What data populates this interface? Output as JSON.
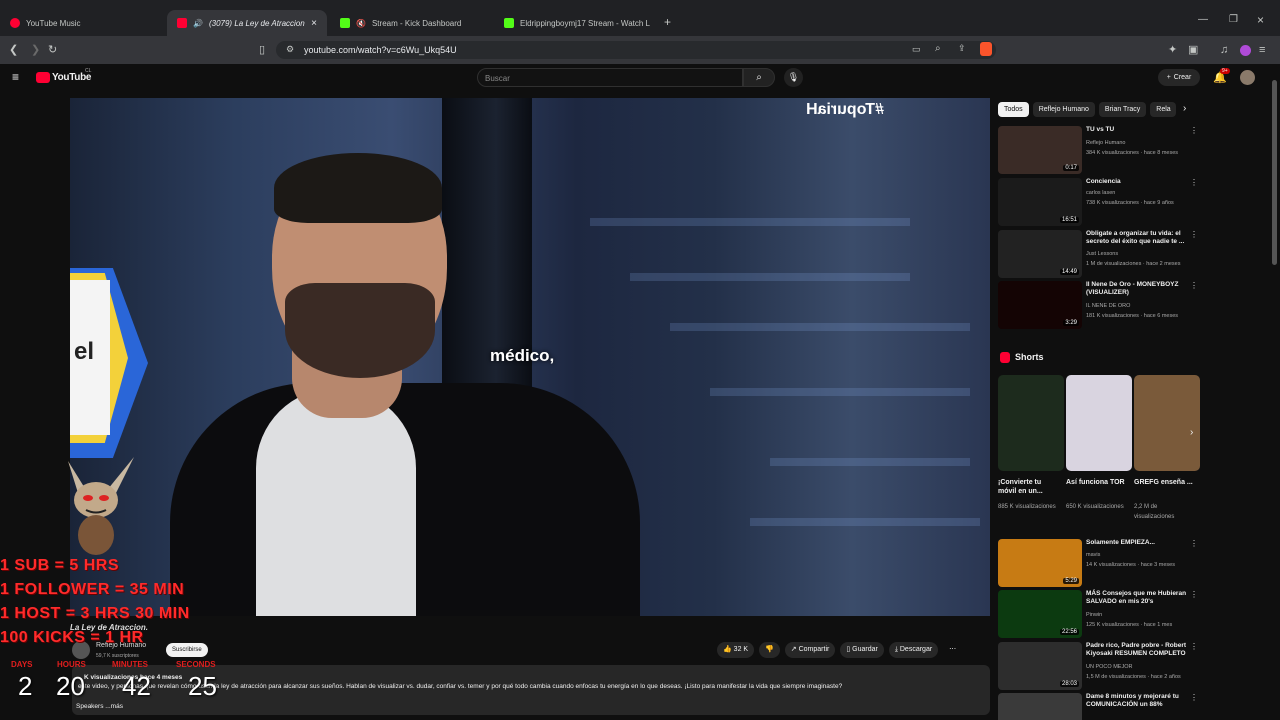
{
  "browser": {
    "tabs": [
      {
        "label": "YouTube Music",
        "color": "#ff0033"
      },
      {
        "label": "(3079) La Ley de Atraccion",
        "color": "#ff0033"
      },
      {
        "label": "Stream - Kick Dashboard",
        "color": "#53fc18"
      },
      {
        "label": "Eldrippingboymj17 Stream - Watch L",
        "color": "#53fc18"
      }
    ],
    "url": "youtube.com/watch?v=c6Wu_Ukq54U"
  },
  "youtube": {
    "logo": "YouTube",
    "region": "CL",
    "search_placeholder": "Buscar",
    "create_label": "Crear",
    "notif_count": "9+"
  },
  "video": {
    "caption": "médico,",
    "hashtag": "#TopuriaH",
    "watermark": "La Ley de Atraccion.",
    "channel": "Reflejo Humano",
    "subs": "59,7 K suscriptores",
    "subscribe_label": "Suscribirse",
    "likes": "32 K",
    "share_label": "Compartir",
    "save_label": "Guardar",
    "download_label": "Descargar",
    "desc_meta": "K visualizaciones hace 4 meses",
    "desc_text": "este video, y personas que revelan cómo usan la ley de atracción para alcanzar sus sueños. Hablan de visualizar vs. dudar, confiar vs. temer y por qué todo cambia cuando enfocas tu energía en lo que deseas. ¡Listo para manifestar la vida que siempre imaginaste?",
    "more_label": "Speakers ...más"
  },
  "chips": [
    "Todos",
    "Reflejo Humano",
    "Brian Tracy",
    "Rela"
  ],
  "related": [
    {
      "title": "TU vs TU",
      "channel": "Reflejo Humano",
      "meta": "384 K visualizaciones · hace 8 meses",
      "duration": "0:17",
      "thumb": "#3a2b26"
    },
    {
      "title": "Conciencia",
      "channel": "carlos lasen",
      "meta": "738 K visualizaciones · hace 9 años",
      "duration": "16:51",
      "thumb": "#1b1b1b"
    },
    {
      "title": "Obligate a organizar tu vida: el secreto del éxito que nadie te ...",
      "channel": "Just Lessons",
      "meta": "1 M de visualizaciones · hace 2 meses",
      "duration": "14:49",
      "thumb": "#222222"
    },
    {
      "title": "Il Nene De Oro - MONEYBOYZ (VISUALIZER)",
      "channel": "IL NENE DE ORO",
      "meta": "181 K visualizaciones · hace 6 meses",
      "duration": "3:29",
      "thumb": "#140404"
    }
  ],
  "shorts_title": "Shorts",
  "shorts": [
    {
      "title": "¡Convierte tu móvil en un...",
      "views": "885 K visualizaciones",
      "thumb": "#1d2b1d"
    },
    {
      "title": "Así funciona TOR",
      "views": "650 K visualizaciones",
      "thumb": "#d9d4e0"
    },
    {
      "title": "GREFG enseña ...",
      "views": "2,2 M de visualizaciones",
      "thumb": "#7a5a3a"
    }
  ],
  "related2": [
    {
      "title": "Solamente EMPIEZA...",
      "channel": "mavis",
      "meta": "14 K visualizaciones · hace 3 meses",
      "duration": "5:29",
      "thumb": "#c77b14"
    },
    {
      "title": "MÁS Consejos que me Hubieran SALVADO en mis 20's",
      "channel": "Pinwin",
      "meta": "125 K visualizaciones · hace 1 mes",
      "duration": "22:56",
      "thumb": "#0c3a10"
    },
    {
      "title": "Padre rico, Padre pobre - Robert Kiyosaki RESUMEN COMPLETO",
      "channel": "UN POCO MEJOR",
      "meta": "1,5 M de visualizaciones · hace 2 años",
      "duration": "28:03",
      "thumb": "#2d2d2d"
    },
    {
      "title": "Dame 8 minutos y mejoraré tu COMUNICACIÓN un 88%",
      "channel": "",
      "meta": "",
      "duration": "",
      "thumb": "#3a3a3a"
    }
  ],
  "overlay": {
    "lines": [
      "1 SUB = 5 HRS",
      "1 FOLLOWER = 35 MIN",
      "1 HOST = 3 HRS 30 MIN",
      "100 KICKS = 1 HR"
    ],
    "timer_labels": [
      "DAYS",
      "HOURS",
      "MINUTES",
      "SECONDS"
    ],
    "timer_values": [
      "2",
      "20",
      "42",
      "25"
    ]
  }
}
